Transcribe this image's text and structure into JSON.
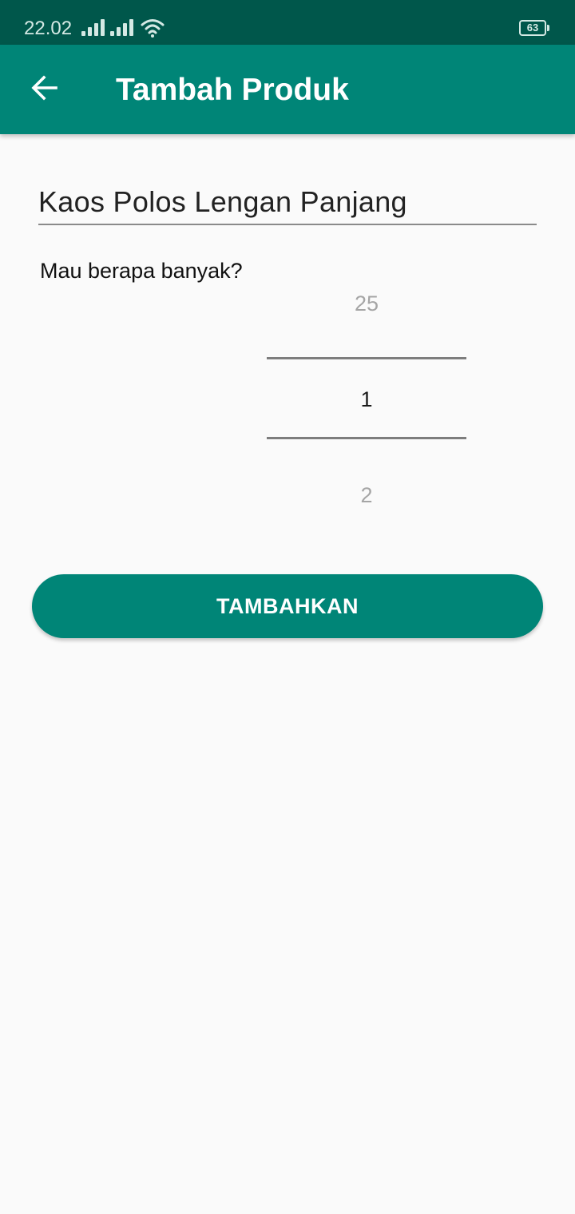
{
  "status_bar": {
    "time": "22.02",
    "battery_level": "63",
    "icons": [
      "signal-icon",
      "signal-icon",
      "wifi-icon",
      "battery-icon"
    ]
  },
  "app_bar": {
    "title": "Tambah Produk",
    "back_icon": "arrow-left-icon"
  },
  "form": {
    "product_name_value": "Kaos Polos Lengan Panjang",
    "quantity_label": "Mau berapa banyak?",
    "quantity_picker": {
      "previous": "25",
      "selected": "1",
      "next": "2"
    },
    "submit_label": "TAMBAHKAN"
  },
  "colors": {
    "status_bar": "#00574b",
    "primary": "#008577",
    "background": "#fafafa"
  }
}
